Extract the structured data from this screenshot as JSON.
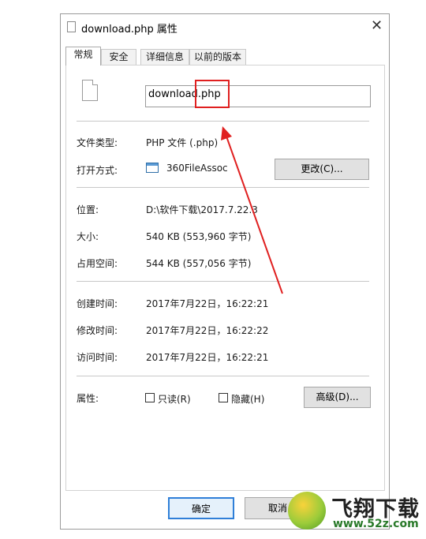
{
  "window": {
    "title": "download.php 属性",
    "close_glyph": "✕"
  },
  "tabs": [
    {
      "label": "常规",
      "active": true
    },
    {
      "label": "安全",
      "active": false
    },
    {
      "label": "详细信息",
      "active": false
    },
    {
      "label": "以前的版本",
      "active": false
    }
  ],
  "file": {
    "name": "download.php"
  },
  "details": {
    "type_label": "文件类型:",
    "type_value": "PHP 文件 (.php)",
    "open_label": "打开方式:",
    "open_value": "360FileAssoc",
    "change_button": "更改(C)...",
    "location_label": "位置:",
    "location_value": "D:\\软件下载\\2017.7.22.3",
    "size_label": "大小:",
    "size_value": "540 KB (553,960 字节)",
    "disk_label": "占用空间:",
    "disk_value": "544 KB (557,056 字节)",
    "created_label": "创建时间:",
    "created_value": "2017年7月22日，16:22:21",
    "modified_label": "修改时间:",
    "modified_value": "2017年7月22日，16:22:22",
    "accessed_label": "访问时间:",
    "accessed_value": "2017年7月22日，16:22:21",
    "attr_label": "属性:",
    "readonly_label": "只读(R)",
    "hidden_label": "隐藏(H)",
    "advanced_button": "高级(D)..."
  },
  "footer": {
    "ok_label": "确定",
    "cancel_label": "取消"
  },
  "watermark": {
    "title": "飞翔下载",
    "url": "www.52z.com"
  },
  "colors": {
    "highlight": "#e02020",
    "arrow": "#e02020",
    "ok_border": "#2f7fd8"
  }
}
